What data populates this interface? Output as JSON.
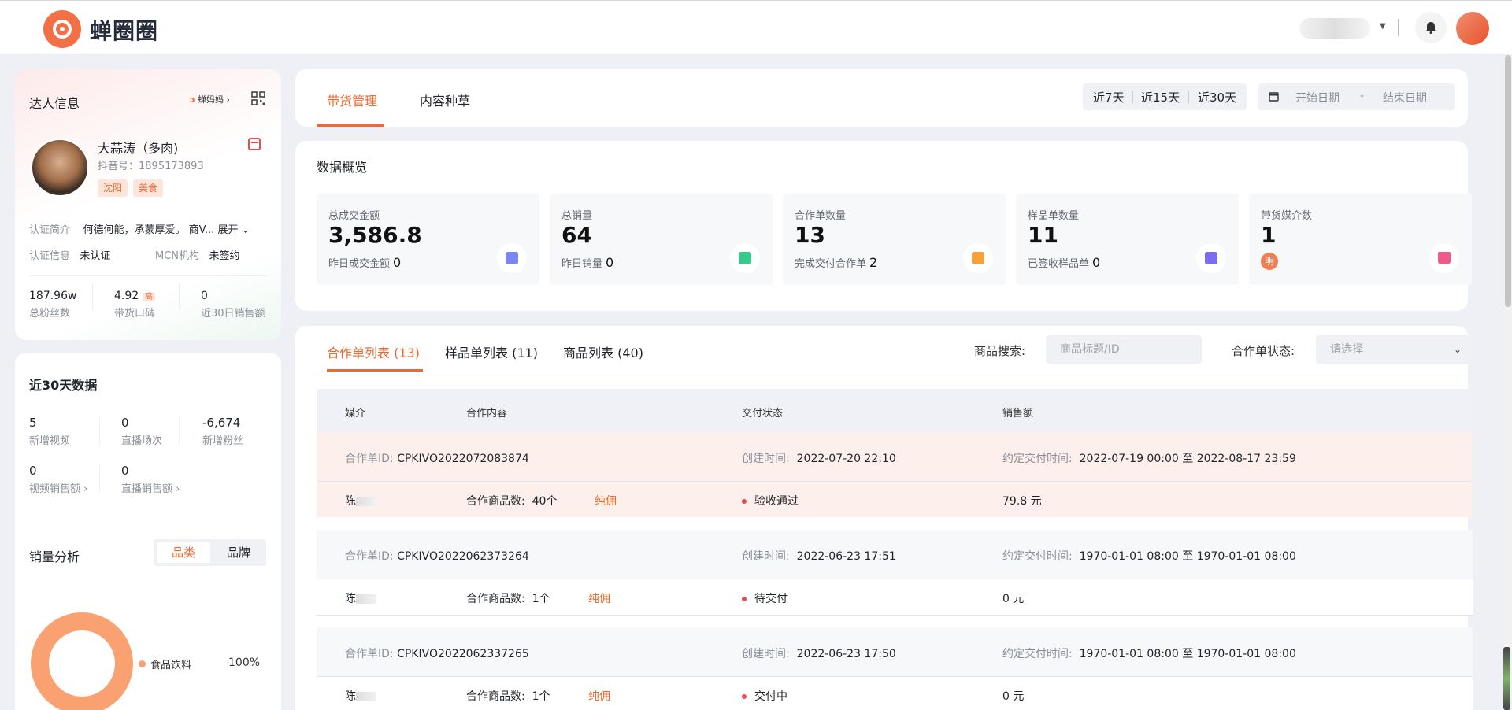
{
  "brand": "蝉圈圈",
  "talent": {
    "title": "达人信息",
    "mama_label": "蝉妈妈",
    "name": "大蒜涛（多肉)",
    "douyin_id": "抖音号：1895173893",
    "tags": [
      "沈阳",
      "美食"
    ],
    "intro_label": "认证简介",
    "intro_text": "何德何能，承蒙厚爱。 商V...",
    "expand": "展开",
    "cert_label": "认证信息",
    "cert_value": "未认证",
    "mcn_label": "MCN机构",
    "mcn_value": "未签约",
    "stats": [
      {
        "value": "187.96w",
        "label": "总粉丝数"
      },
      {
        "value": "4.92",
        "badge": "高",
        "label": "带货口碑"
      },
      {
        "value": "0",
        "label": "近30日销售额"
      }
    ]
  },
  "stats30": {
    "title": "近30天数据",
    "items": [
      {
        "value": "5",
        "label": "新增视频"
      },
      {
        "value": "0",
        "label": "直播场次"
      },
      {
        "value": "-6,674",
        "label": "新增粉丝"
      },
      {
        "value": "0",
        "label": "视频销售额 ›"
      },
      {
        "value": "0",
        "label": "直播销售额 ›"
      }
    ],
    "sales_title": "销量分析",
    "seg_category": "品类",
    "seg_brand": "品牌",
    "legend_name": "食品饮料",
    "legend_pct": "100%"
  },
  "tabs": [
    "带货管理",
    "内容种草"
  ],
  "ranges": [
    "近7天",
    "近15天",
    "近30天"
  ],
  "date": {
    "start": "开始日期",
    "sep": "-",
    "end": "结束日期"
  },
  "overview": {
    "title": "数据概览",
    "metrics": [
      {
        "label": "总成交金额",
        "value": "3,586.8",
        "sub": "昨日成交金额",
        "sub_value": "0",
        "icon": "money-icon",
        "color": "#6b74f0"
      },
      {
        "label": "总销量",
        "value": "64",
        "sub": "昨日销量",
        "sub_value": "0",
        "icon": "battery-icon",
        "color": "#35c98a"
      },
      {
        "label": "合作单数量",
        "value": "13",
        "sub": "完成交付合作单",
        "sub_value": "2",
        "icon": "clipboard-icon",
        "color": "#f5a03a"
      },
      {
        "label": "样品单数量",
        "value": "11",
        "sub": "已签收样品单",
        "sub_value": "0",
        "icon": "bag-icon",
        "color": "#7b6cf0"
      },
      {
        "label": "带货媒介数",
        "value": "1",
        "badge": "明",
        "icon": "crown-icon",
        "color": "#ee5a8a"
      }
    ]
  },
  "list": {
    "tabs": [
      "合作单列表 (13)",
      "样品单列表 (11)",
      "商品列表 (40)"
    ],
    "search_label": "商品搜索:",
    "search_placeholder": "商品标题/ID",
    "status_label": "合作单状态:",
    "status_placeholder": "请选择",
    "headers": [
      "媒介",
      "合作内容",
      "交付状态",
      "销售额"
    ],
    "id_label": "合作单ID:",
    "created_label": "创建时间:",
    "due_label": "约定交付时间:",
    "to": "至",
    "count_label": "合作商品数:",
    "pure": "纯佣",
    "rows": [
      {
        "id": "CPKIVO2022072083874",
        "created": "2022-07-20 22:10",
        "due_start": "2022-07-19 00:00",
        "due_end": "2022-08-17 23:59",
        "media": "陈",
        "count": "40个",
        "status": "验收通过",
        "sales": "79.8 元"
      },
      {
        "id": "CPKIVO2022062373264",
        "created": "2022-06-23 17:51",
        "due_start": "1970-01-01 08:00",
        "due_end": "1970-01-01 08:00",
        "media": "陈",
        "count": "1个",
        "status": "待交付",
        "sales": "0 元"
      },
      {
        "id": "CPKIVO2022062337265",
        "created": "2022-06-23 17:50",
        "due_start": "1970-01-01 08:00",
        "due_end": "1970-01-01 08:00",
        "media": "陈",
        "count": "1个",
        "status": "交付中",
        "sales": "0 元"
      }
    ]
  }
}
